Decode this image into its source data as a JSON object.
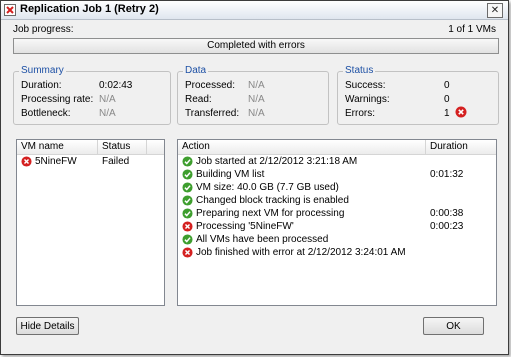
{
  "window": {
    "title": "Replication Job 1 (Retry 2)",
    "close_symbol": "✕"
  },
  "progress": {
    "label": "Job progress:",
    "count": "1 of 1 VMs",
    "bar_text": "Completed with errors",
    "fraction": 1.0
  },
  "summary": {
    "title": "Summary",
    "rows": [
      {
        "label": "Duration:",
        "value": "0:02:43"
      },
      {
        "label": "Processing rate:",
        "value": "N/A"
      },
      {
        "label": "Bottleneck:",
        "value": "N/A"
      }
    ]
  },
  "data": {
    "title": "Data",
    "rows": [
      {
        "label": "Processed:",
        "value": "N/A"
      },
      {
        "label": "Read:",
        "value": "N/A"
      },
      {
        "label": "Transferred:",
        "value": "N/A"
      }
    ]
  },
  "status": {
    "title": "Status",
    "rows": [
      {
        "label": "Success:",
        "value": "0"
      },
      {
        "label": "Warnings:",
        "value": "0"
      },
      {
        "label": "Errors:",
        "value": "1"
      }
    ]
  },
  "vm_table": {
    "headers": {
      "name": "VM name",
      "status": "Status"
    },
    "rows": [
      {
        "name": "5NineFW",
        "status": "Failed",
        "icon": "error-icon"
      }
    ]
  },
  "action_table": {
    "headers": {
      "action": "Action",
      "duration": "Duration"
    },
    "rows": [
      {
        "icon": "success-icon",
        "action": "Job started at 2/12/2012 3:21:18 AM",
        "duration": ""
      },
      {
        "icon": "success-icon",
        "action": "Building VM list",
        "duration": "0:01:32"
      },
      {
        "icon": "success-icon",
        "action": "VM size: 40.0 GB (7.7 GB used)",
        "duration": ""
      },
      {
        "icon": "success-icon",
        "action": "Changed block tracking is enabled",
        "duration": ""
      },
      {
        "icon": "success-icon",
        "action": "Preparing next VM for processing",
        "duration": "0:00:38"
      },
      {
        "icon": "error-icon",
        "action": "Processing '5NineFW'",
        "duration": "0:00:23"
      },
      {
        "icon": "success-icon",
        "action": "All VMs have been processed",
        "duration": ""
      },
      {
        "icon": "error-icon",
        "action": "Job finished with error at 2/12/2012 3:24:01 AM",
        "duration": ""
      }
    ]
  },
  "buttons": {
    "hide_details": "Hide Details",
    "ok": "OK"
  },
  "colors": {
    "group_title": "#1e51a5",
    "error_red": "#d42020",
    "success_green": "#3e9e2e",
    "na_gray": "#888888"
  }
}
